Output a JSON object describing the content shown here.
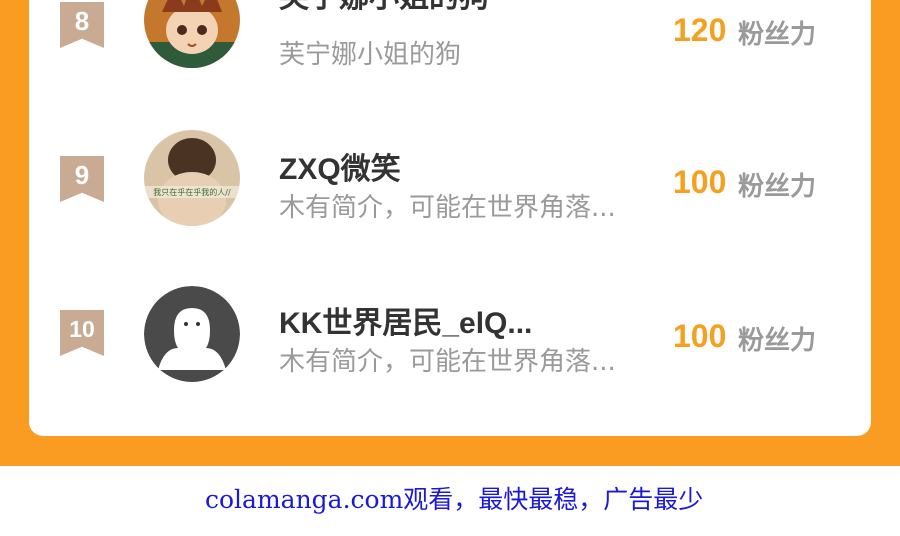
{
  "ranking": {
    "unit_label": "粉丝力",
    "rows": [
      {
        "rank": "8",
        "name": "芙宁娜小姐的狗",
        "bio": "芙宁娜小姐的狗",
        "score": "120",
        "avatar": "anime-boy-avatar"
      },
      {
        "rank": "9",
        "name": "ZXQ微笑",
        "bio": "木有简介，可能在世界角落...",
        "score": "100",
        "avatar": "photo-avatar",
        "avatar_caption": "我只在乎在乎我的人//"
      },
      {
        "rank": "10",
        "name": "KK世界居民_elQ...",
        "bio": "木有简介，可能在世界角落...",
        "score": "100",
        "avatar": "default-ghost-avatar"
      }
    ]
  },
  "footer": {
    "watermark": "colamanga.com观看，最快最稳，广告最少"
  },
  "colors": {
    "frame": "#fa9c22",
    "score": "#f4a020",
    "badge": "#c9ab93",
    "footer_link": "#1a1ad6"
  }
}
